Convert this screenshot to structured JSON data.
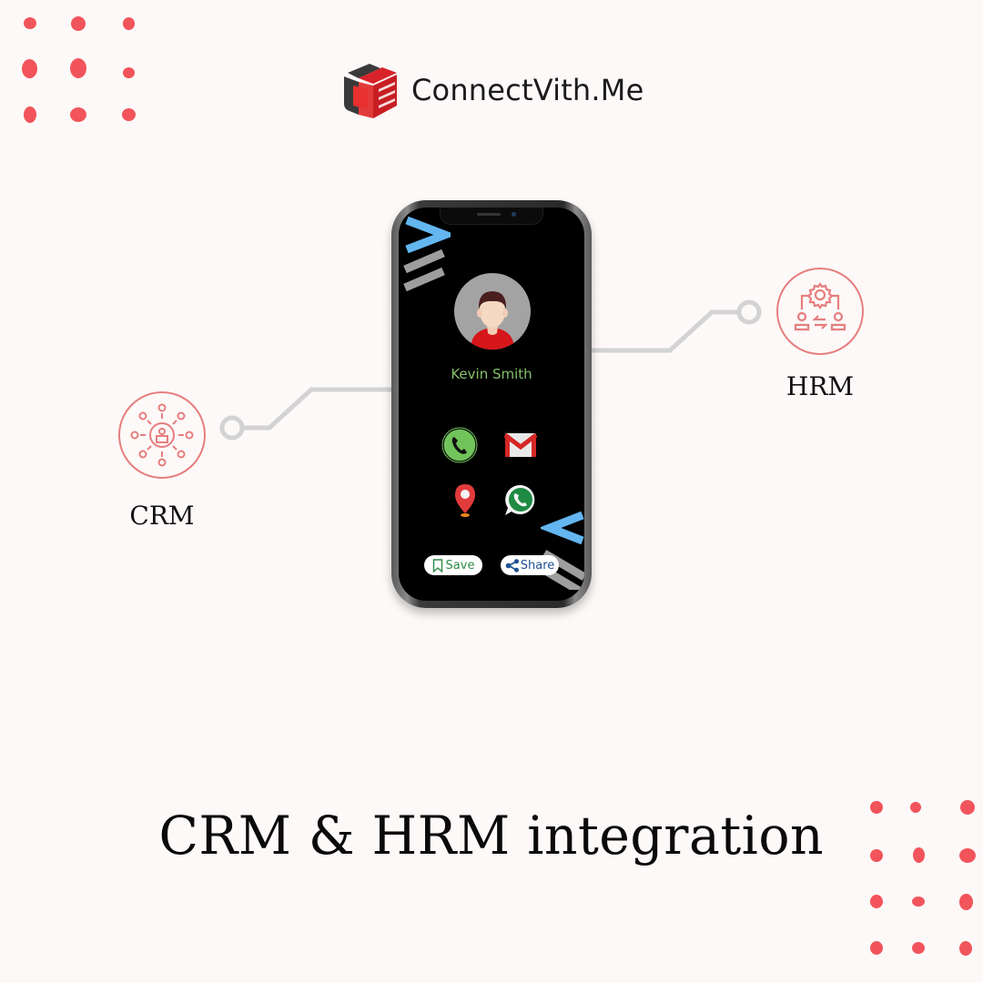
{
  "brand": {
    "name": "ConnectVith.Me",
    "logo_icon": "red-cube-logo-icon",
    "accent_color": "#e02424"
  },
  "colors": {
    "background": "#fdf9f8",
    "dots": "#f2545b",
    "badge_stroke": "#e67e7e",
    "connector": "#d3d3d3",
    "contact_name": "#86c06b",
    "chevron_blue": "#63b6f0",
    "chevron_gray": "#9e9e9e"
  },
  "phone": {
    "contact": {
      "name": "Kevin Smith",
      "avatar_icon": "person-avatar-icon"
    },
    "actions": [
      {
        "name": "phone",
        "icon": "phone-icon"
      },
      {
        "name": "email",
        "icon": "gmail-icon"
      },
      {
        "name": "location",
        "icon": "map-pin-icon"
      },
      {
        "name": "whatsapp",
        "icon": "whatsapp-icon"
      }
    ],
    "buttons": {
      "save_label": "Save",
      "share_label": "Share"
    }
  },
  "integrations": {
    "crm": {
      "label": "CRM",
      "icon": "crm-network-icon"
    },
    "hrm": {
      "label": "HRM",
      "icon": "hrm-gear-exchange-icon"
    }
  },
  "headline": "CRM & HRM integration"
}
